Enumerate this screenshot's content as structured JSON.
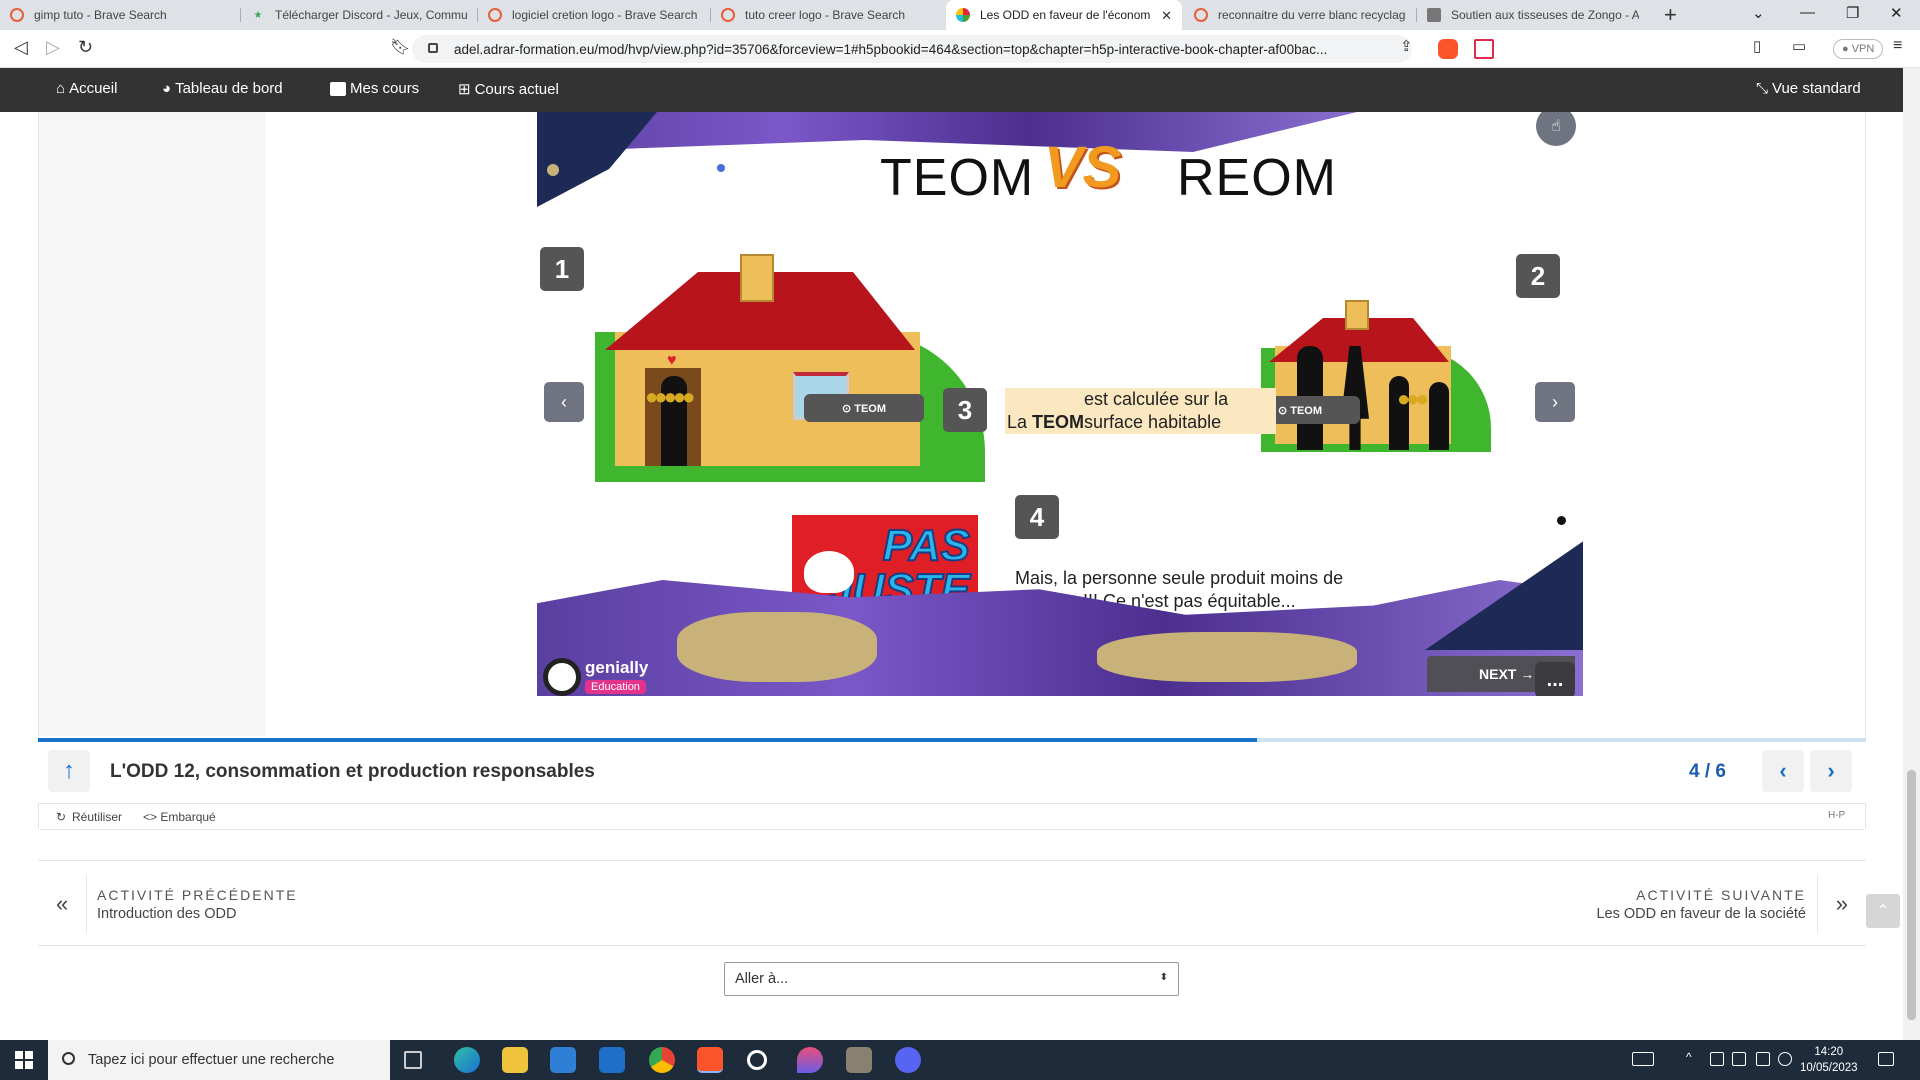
{
  "browser": {
    "tabs": [
      {
        "title": "gimp tuto - Brave Search",
        "icon": "brave-search-icon",
        "color": "#e85d3a"
      },
      {
        "title": "Télécharger Discord - Jeux, Communa",
        "icon": "star-icon",
        "color": "#3ba55c"
      },
      {
        "title": "logiciel cretion logo - Brave Search",
        "icon": "brave-search-icon",
        "color": "#e85d3a"
      },
      {
        "title": "tuto creer logo - Brave Search",
        "icon": "brave-search-icon",
        "color": "#e85d3a"
      },
      {
        "title": "Les ODD en faveur de l'économie",
        "icon": "odd-icon",
        "color": "#4a90d9",
        "active": true
      },
      {
        "title": "reconnaitre du verre blanc recyclage",
        "icon": "brave-search-icon",
        "color": "#e85d3a"
      },
      {
        "title": "Soutien aux tisseuses de Zongo - Arts",
        "icon": "page-icon",
        "color": "#777777"
      }
    ],
    "tab_close": "✕",
    "new_tab": "+",
    "url": "adel.adrar-formation.eu/mod/hvp/view.php?id=35706&forceview=1#h5pbookid=464&section=top&chapter=h5p-interactive-book-chapter-af00bac...",
    "vpn": "● VPN",
    "brave_badge": "1",
    "rewards_badge": "1"
  },
  "sitenav": {
    "items": [
      "Accueil",
      "Tableau de bord",
      "Mes cours",
      "Cours actuel"
    ],
    "right": "Vue standard"
  },
  "stage": {
    "title_left": "TEOM",
    "title_right": "REOM",
    "vs": "VS",
    "num1": "1",
    "num2": "2",
    "num3": "3",
    "num4": "4",
    "teom_btn": "⊙ TEOM",
    "text3_prefix": "La ",
    "text3_bold": "TEOM",
    "text3_rest": " est calculée sur la surface habitable",
    "pas": "PAS",
    "juste": "JUSTE",
    "text4": "Mais, la personne seule produit moins de déchets !!! Ce n'est pas équitable...",
    "genially": "genially",
    "genially_tag": "Education",
    "next": "NEXT →",
    "more": "..."
  },
  "book": {
    "progress": 0.667,
    "chapter_title": "L'ODD 12, consommation et production responsables",
    "page_counter": "4 / 6",
    "reuse": "Réutiliser",
    "embed": "<> Embarqué",
    "h5p": "H-P"
  },
  "activity_nav": {
    "prev_caption": "ACTIVITÉ PRÉCÉDENTE",
    "prev_name": "Introduction des ODD",
    "next_caption": "ACTIVITÉ SUIVANTE",
    "next_name": "Les ODD en faveur de la société",
    "jump_placeholder": "Aller à..."
  },
  "taskbar": {
    "search": "Tapez ici pour effectuer une recherche",
    "time": "14:20",
    "date": "10/05/2023"
  }
}
